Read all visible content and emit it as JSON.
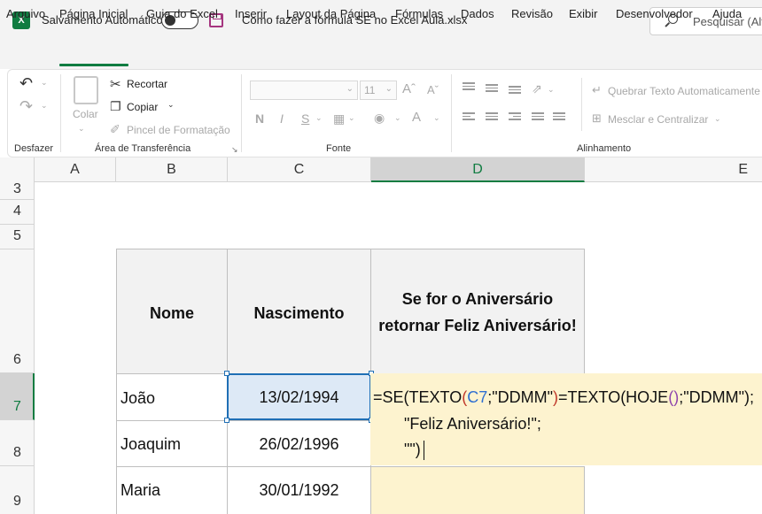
{
  "titlebar": {
    "app_icon": "excel-icon",
    "autosave_label": "Salvamento Automático",
    "autosave_state": "off",
    "document_title": "Como fazer a fórmula SE no Excel Aula.xlsx",
    "search_placeholder": "Pesquisar (Alt"
  },
  "menu": {
    "tabs": [
      "Arquivo",
      "Página Inicial",
      "Guia do Excel",
      "Inserir",
      "Layout da Página",
      "Fórmulas",
      "Dados",
      "Revisão",
      "Exibir",
      "Desenvolvedor",
      "Ajuda"
    ],
    "active_tab": "Página Inicial"
  },
  "ribbon": {
    "undo_group_label": "Desfazer",
    "clipboard": {
      "paste_label": "Colar",
      "cut_label": "Recortar",
      "copy_label": "Copiar",
      "format_painter_label": "Pincel de Formatação",
      "group_label": "Área de Transferência"
    },
    "font": {
      "font_name": "",
      "font_size": "11",
      "bold_label": "N",
      "italic_label": "I",
      "underline_label": "S",
      "group_label": "Fonte"
    },
    "alignment": {
      "wrap_text_label": "Quebrar Texto Automaticamente",
      "merge_center_label": "Mesclar e Centralizar",
      "group_label": "Alinhamento"
    }
  },
  "grid": {
    "columns": [
      "A",
      "B",
      "C",
      "D",
      "E"
    ],
    "selected_column": "D",
    "rows": [
      "3",
      "4",
      "5",
      "6",
      "7",
      "8",
      "9"
    ],
    "selected_row": "7"
  },
  "table": {
    "headers": {
      "name": "Nome",
      "birth": "Nascimento",
      "rule_line1": "Se for o Aniversário",
      "rule_line2": "retornar Feliz Aniversário!"
    },
    "rows": [
      {
        "name": "João",
        "birth": "13/02/1994"
      },
      {
        "name": "Joaquim",
        "birth": "26/02/1996"
      },
      {
        "name": "Maria",
        "birth": "30/01/1992"
      }
    ]
  },
  "formula": {
    "line1": {
      "p1": "=SE(TEXTO",
      "p2": "(",
      "ref": "C7",
      "p3": ";\"DDMM\"",
      "p4": ")",
      "p5": "=TEXTO(HOJE",
      "p6": "()",
      "p7": ";\"DDMM\");"
    },
    "line2": "\"Feliz Aniversário!\";",
    "line3": "\"\")"
  }
}
